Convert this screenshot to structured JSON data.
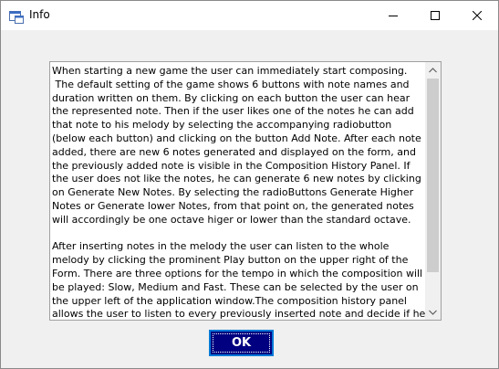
{
  "window": {
    "title": "Info",
    "app_icon": "form-window-icon",
    "controls": {
      "minimize_icon": "minimize-icon",
      "maximize_icon": "maximize-icon",
      "close_icon": "close-icon"
    }
  },
  "info_text": "When starting a new game the user can immediately start composing.\n The default setting of the game shows 6 buttons with note names and duration written on them. By clicking on each button the user can hear the represented note. Then if the user likes one of the notes he can add that note to his melody by selecting the accompanying radiobutton (below each button) and clicking on the button Add Note. After each note added, there are new 6 notes generated and displayed on the form, and the previously added note is visible in the Composition History Panel. If the user does not like the notes, he can generate 6 new notes by clicking on Generate New Notes. By selecting the radioButtons Generate Higher Notes or Generate lower Notes, from that point on, the generated notes will accordingly be one octave higer or lower than the standard octave.\n\nAfter inserting notes in the melody the user can listen to the whole melody by clicking the prominent Play button on the upper right of the Form. There are three options for the tempo in which the composition will be played: Slow, Medium and Fast. These can be selected by the user on the upper left of the application window.The composition history panel allows the user to listen to every previously inserted note and decide if he wants to delete it",
  "ok_button": {
    "label": "OK"
  },
  "colors": {
    "ok_background": "#000080",
    "ok_border": "#0078d7",
    "dialog_background": "#f0f0f0"
  }
}
